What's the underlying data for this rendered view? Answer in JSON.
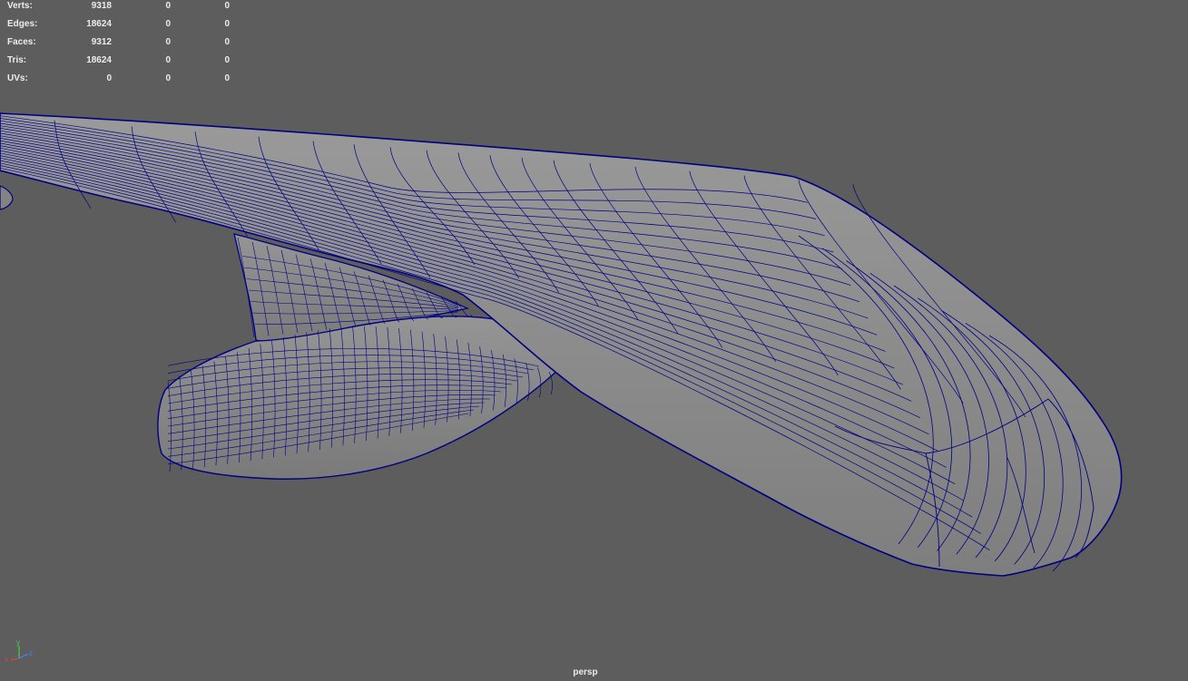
{
  "hud": {
    "rows": [
      {
        "label": "Verts:",
        "values": [
          "9318",
          "0",
          "0"
        ]
      },
      {
        "label": "Edges:",
        "values": [
          "18624",
          "0",
          "0"
        ]
      },
      {
        "label": "Faces:",
        "values": [
          "9312",
          "0",
          "0"
        ]
      },
      {
        "label": "Tris:",
        "values": [
          "18624",
          "0",
          "0"
        ]
      },
      {
        "label": "UVs:",
        "values": [
          "0",
          "0",
          "0"
        ]
      }
    ]
  },
  "viewport": {
    "camera": "persp",
    "background_color": "#5d5d5d",
    "mesh_fill_color": "#8b8b8b",
    "wireframe_color": "#000080"
  },
  "axis_gizmo": {
    "x_label": "x",
    "y_label": "y",
    "z_label": "z",
    "x_color": "#e04040",
    "y_color": "#40d040",
    "z_color": "#4080ff"
  }
}
